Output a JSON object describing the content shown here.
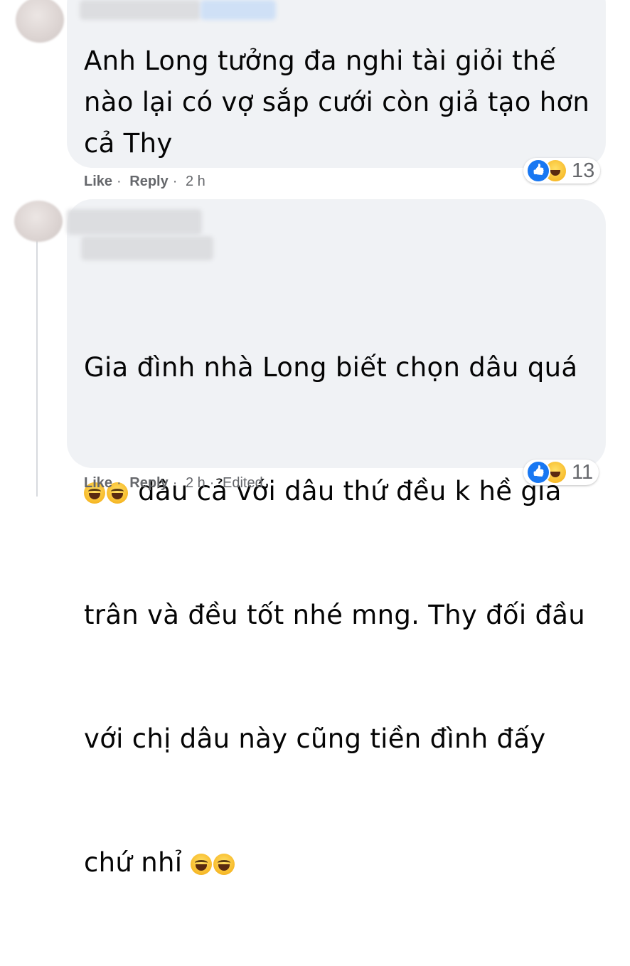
{
  "comments": [
    {
      "text": "Anh Long tưởng đa nghi tài giỏi thế\nnào lại có vợ sắp cưới còn giả tạo hơn\ncả Thy",
      "actions": {
        "like": "Like",
        "reply": "Reply",
        "time": "2 h"
      },
      "reaction_count": "13",
      "reaction_icons": [
        "like-icon",
        "haha-icon"
      ]
    },
    {
      "line1": "Gia đình nhà Long biết chọn dâu quá",
      "line2": "dâu cả với dâu thứ đều k hề giả",
      "line3": "trân và đều tốt nhé mng. Thy đối đầu",
      "line4": "với chị dâu này cũng tiền đình đấy",
      "line5": "chứ nhỉ",
      "actions": {
        "like": "Like",
        "reply": "Reply",
        "time": "2 h",
        "edited": "Edited"
      },
      "reaction_count": "11",
      "reaction_icons": [
        "like-icon",
        "haha-icon"
      ]
    }
  ],
  "separator": "·",
  "colors": {
    "bubble": "#f0f2f5",
    "meta": "#65676b",
    "like_blue": "#1877f2",
    "haha": "#f7b928"
  }
}
